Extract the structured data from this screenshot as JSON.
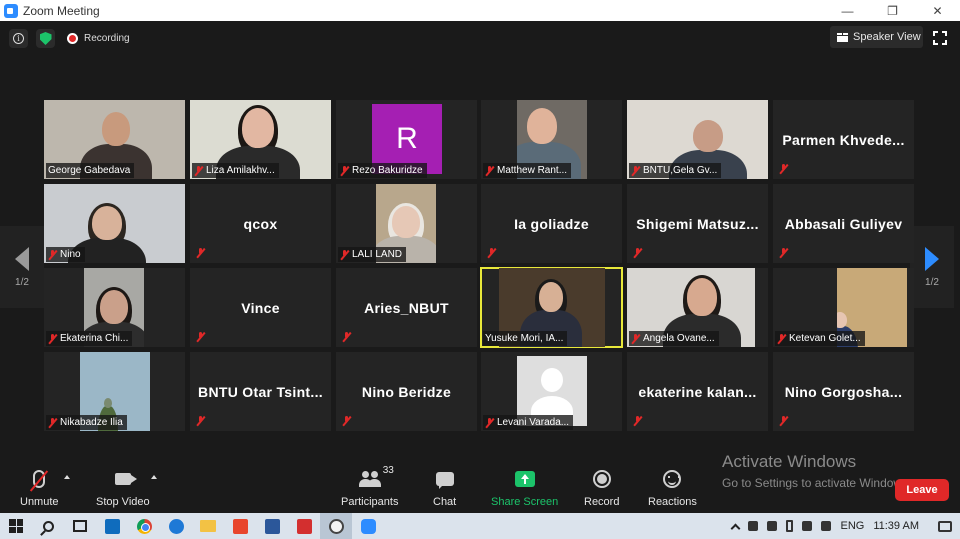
{
  "window": {
    "title": "Zoom Meeting",
    "minimize_glyph": "—",
    "restore_glyph": "❐",
    "close_glyph": "✕"
  },
  "topbar": {
    "info_glyph": "i",
    "recording_label": "Recording",
    "speaker_view_label": "Speaker View"
  },
  "pagination": {
    "current": "1/2",
    "left_count": "1/2"
  },
  "tiles": [
    {
      "name": "George Gabedava",
      "type": "video",
      "muted": false
    },
    {
      "name": "Liza Amilakhv...",
      "type": "video",
      "muted": true
    },
    {
      "name": "Rezo Bakuridze",
      "type": "avatar",
      "initial": "R",
      "muted": true
    },
    {
      "name": "Matthew Rant...",
      "type": "video",
      "muted": true
    },
    {
      "name": "BNTU,Gela Gv...",
      "type": "video",
      "muted": true
    },
    {
      "name": "Parmen  Khvede...",
      "type": "name",
      "muted": true
    },
    {
      "name": "Nino",
      "type": "video",
      "muted": true
    },
    {
      "name": "qcox",
      "type": "name",
      "muted": true
    },
    {
      "name": "LALI LAND",
      "type": "video",
      "muted": true
    },
    {
      "name": "Ia goliadze",
      "type": "name",
      "muted": true
    },
    {
      "name": "Shigemi  Matsuz...",
      "type": "name",
      "muted": true
    },
    {
      "name": "Abbasali Guliyev",
      "type": "name",
      "muted": true
    },
    {
      "name": "Ekaterina Chi...",
      "type": "video",
      "muted": true
    },
    {
      "name": "Vince",
      "type": "name",
      "muted": true
    },
    {
      "name": "Aries_NBUT",
      "type": "name",
      "muted": true
    },
    {
      "name": "Yusuke Mori, IA...",
      "type": "video",
      "muted": false,
      "active": true
    },
    {
      "name": "Angela Ovane...",
      "type": "video",
      "muted": true
    },
    {
      "name": "Ketevan Golet...",
      "type": "video",
      "muted": true
    },
    {
      "name": "Nikabadze Ilia",
      "type": "video",
      "muted": true
    },
    {
      "name": "BNTU  Otar  Tsint...",
      "type": "name",
      "muted": true
    },
    {
      "name": "Nino Beridze",
      "type": "name",
      "muted": true
    },
    {
      "name": "Levani Varada...",
      "type": "placeholder",
      "muted": true
    },
    {
      "name": "ekaterine  kalan...",
      "type": "name",
      "muted": true
    },
    {
      "name": "Nino  Gorgosha...",
      "type": "name",
      "muted": true
    }
  ],
  "toolbar": {
    "unmute": "Unmute",
    "stop_video": "Stop Video",
    "participants": "Participants",
    "participants_count": "33",
    "chat": "Chat",
    "share_screen": "Share Screen",
    "record": "Record",
    "reactions": "Reactions",
    "leave": "Leave"
  },
  "watermark": {
    "line1": "Activate Windows",
    "line2": "Go to Settings to activate Windows."
  },
  "taskbar": {
    "language": "ENG",
    "time": "11:39 AM",
    "apps": [
      "windows-start",
      "search",
      "task-view",
      "outlook",
      "chrome",
      "edge",
      "file-explorer",
      "anydesk",
      "word",
      "acrobat",
      "zoom-active",
      "zoom"
    ]
  },
  "colors": {
    "accent_blue": "#2d8cff",
    "muted_red": "#e02828",
    "share_green": "#1cc36a",
    "active_speaker": "#e8e83a",
    "leave_red": "#e02828"
  }
}
